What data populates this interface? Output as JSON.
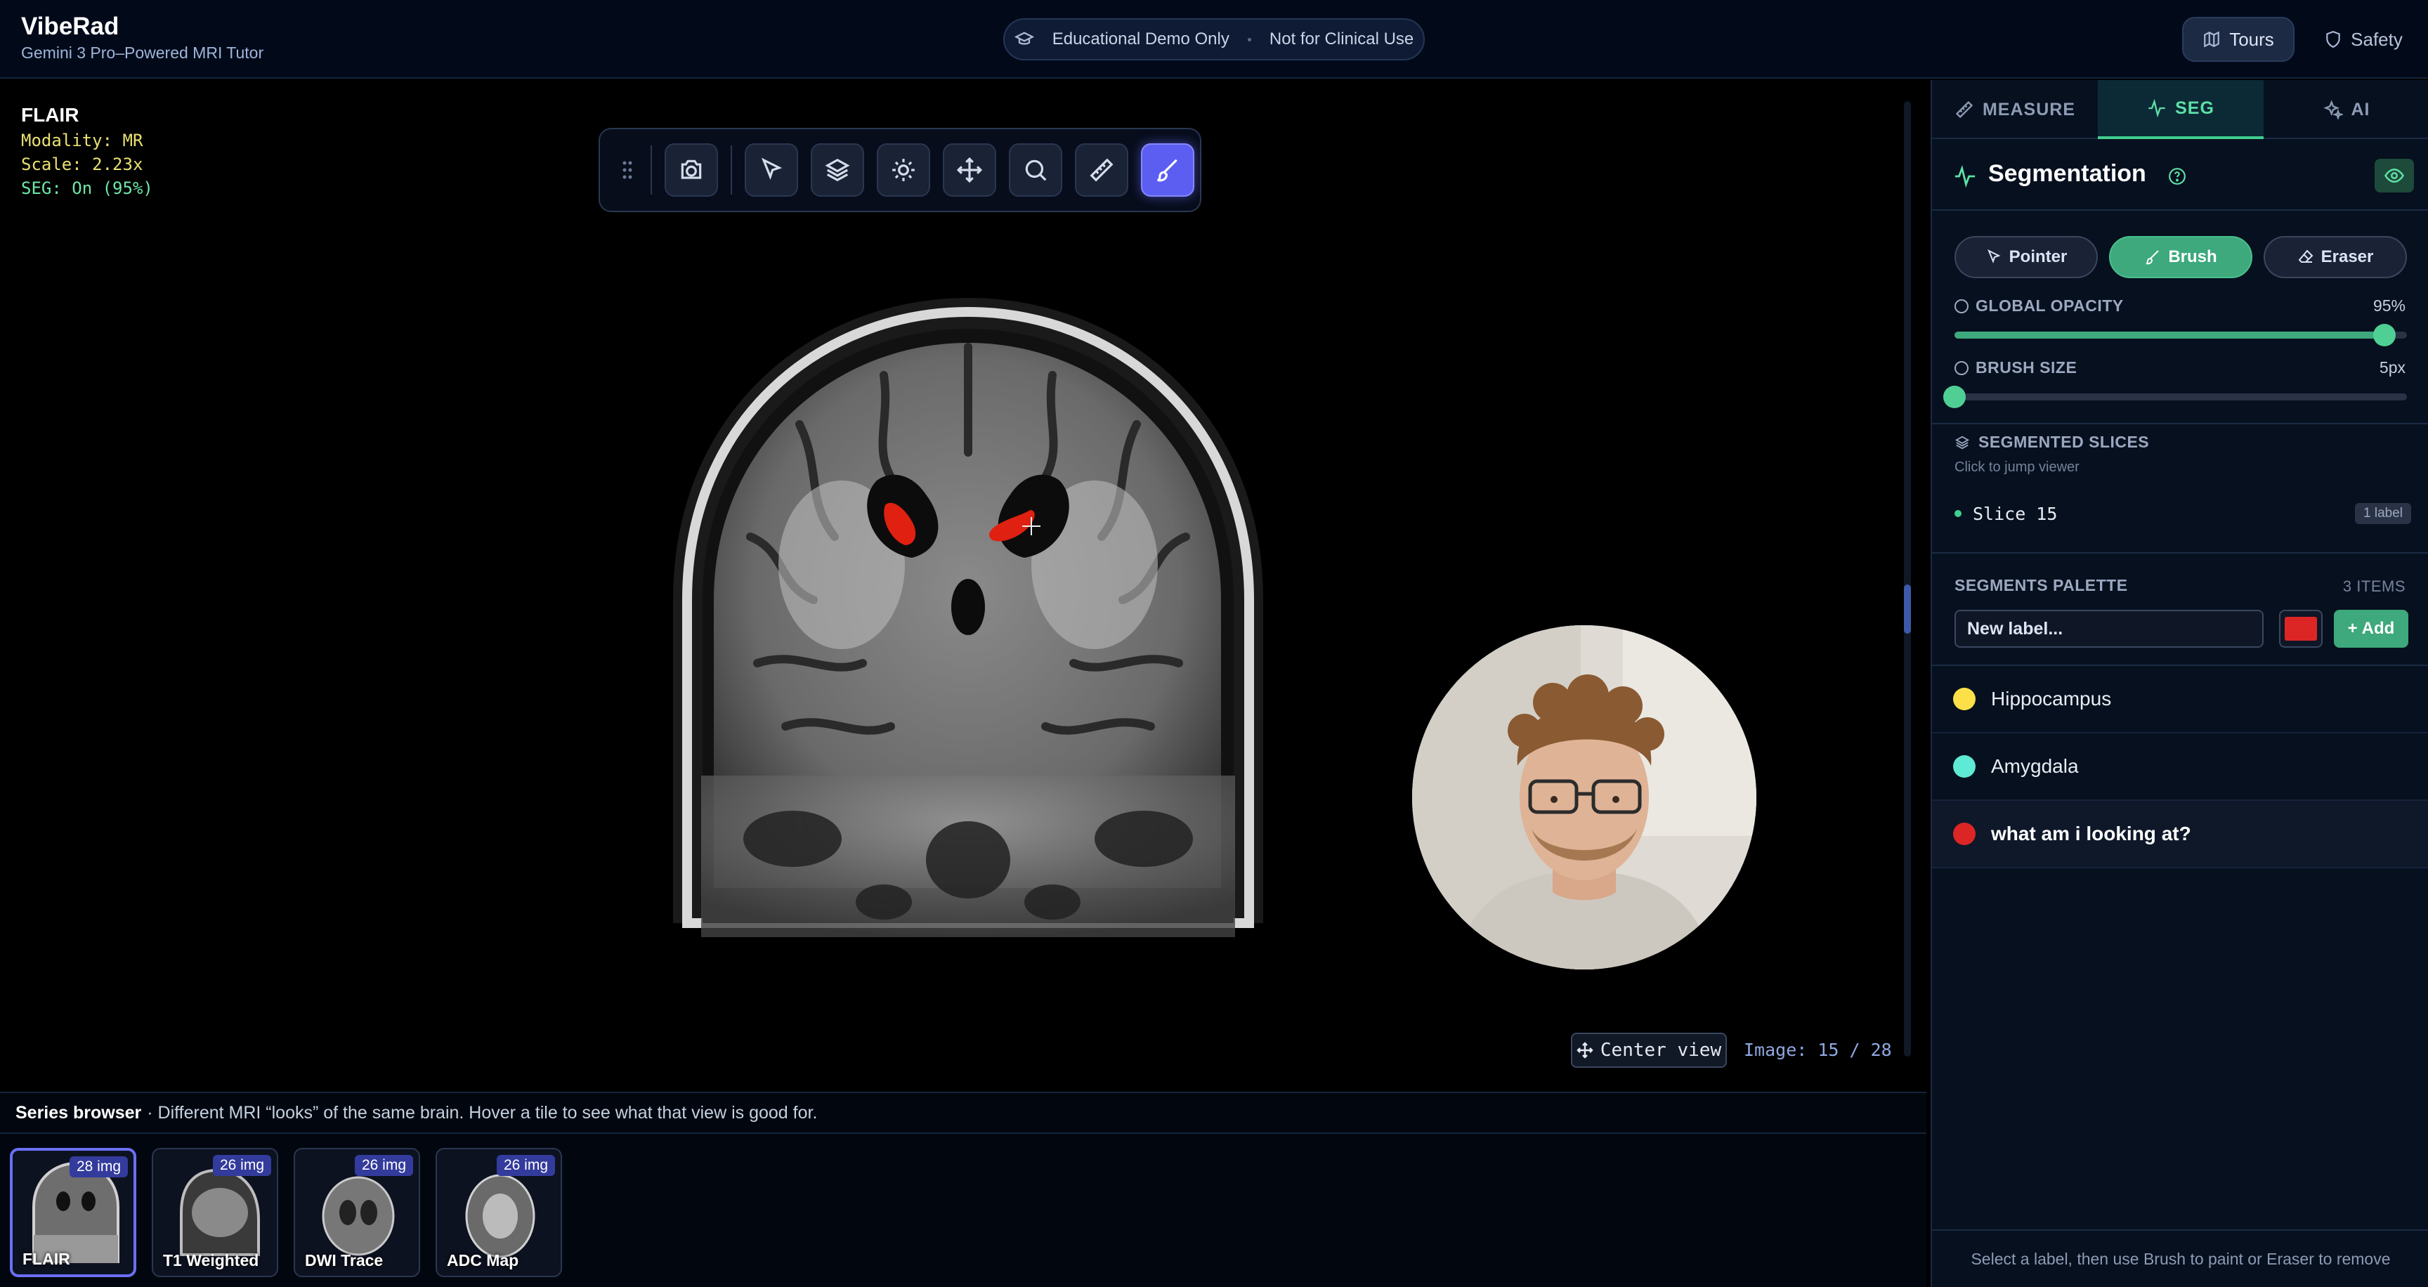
{
  "app": {
    "title": "VibeRad",
    "subtitle": "Gemini 3 Pro–Powered MRI Tutor"
  },
  "header": {
    "demo_label": "Educational Demo Only",
    "disclaimer": "Not for Clinical Use",
    "tours_label": "Tours",
    "safety_label": "Safety"
  },
  "viewer": {
    "series_name": "FLAIR",
    "modality": "Modality: MR",
    "scale": "Scale: 2.23x",
    "seg_status": "SEG: On (95%)",
    "center_view_label": "Center view",
    "image_counter": "Image: 15 / 28",
    "active_tool": "brush",
    "toolbar_icons": [
      "drag-handle-icon",
      "camera-icon",
      "pointer-icon",
      "layers-icon",
      "brightness-icon",
      "pan-icon",
      "zoom-icon",
      "ruler-icon",
      "brush-icon"
    ]
  },
  "series_browser": {
    "title": "Series browser",
    "description": "· Different MRI “looks” of the same brain. Hover a tile to see what that view is good for.",
    "tiles": [
      {
        "label": "FLAIR",
        "count": "28 img",
        "active": true
      },
      {
        "label": "T1 Weighted",
        "count": "26 img",
        "active": false
      },
      {
        "label": "DWI Trace",
        "count": "26 img",
        "active": false
      },
      {
        "label": "ADC Map",
        "count": "26 img",
        "active": false
      }
    ]
  },
  "panel": {
    "tabs": [
      {
        "label": "MEASURE",
        "icon": "ruler-icon"
      },
      {
        "label": "SEG",
        "icon": "activity-icon",
        "active": true
      },
      {
        "label": "AI",
        "icon": "sparkles-icon"
      }
    ],
    "seg_title": "Segmentation",
    "modes": {
      "pointer": "Pointer",
      "brush": "Brush",
      "eraser": "Eraser",
      "active": "brush"
    },
    "opacity": {
      "label": "GLOBAL OPACITY",
      "value_text": "95%",
      "value": 0.95
    },
    "brush_size": {
      "label": "BRUSH SIZE",
      "value_text": "5px",
      "value": 0.0
    },
    "slices": {
      "title": "SEGMENTED SLICES",
      "hint": "Click to jump viewer",
      "items": [
        {
          "name": "Slice 15",
          "badge": "1 label"
        }
      ]
    },
    "palette": {
      "title": "SEGMENTS PALETTE",
      "count": "3 ITEMS",
      "input_placeholder": "New label...",
      "selected_color": "#dc2626",
      "add_label": "Add",
      "items": [
        {
          "name": "Hippocampus",
          "color": "#fde047"
        },
        {
          "name": "Amygdala",
          "color": "#5eead4"
        },
        {
          "name": "what am i looking at?",
          "color": "#dc2626",
          "selected": true
        }
      ]
    },
    "footer": "Select a label, then use Brush to paint or Eraser to remove"
  }
}
